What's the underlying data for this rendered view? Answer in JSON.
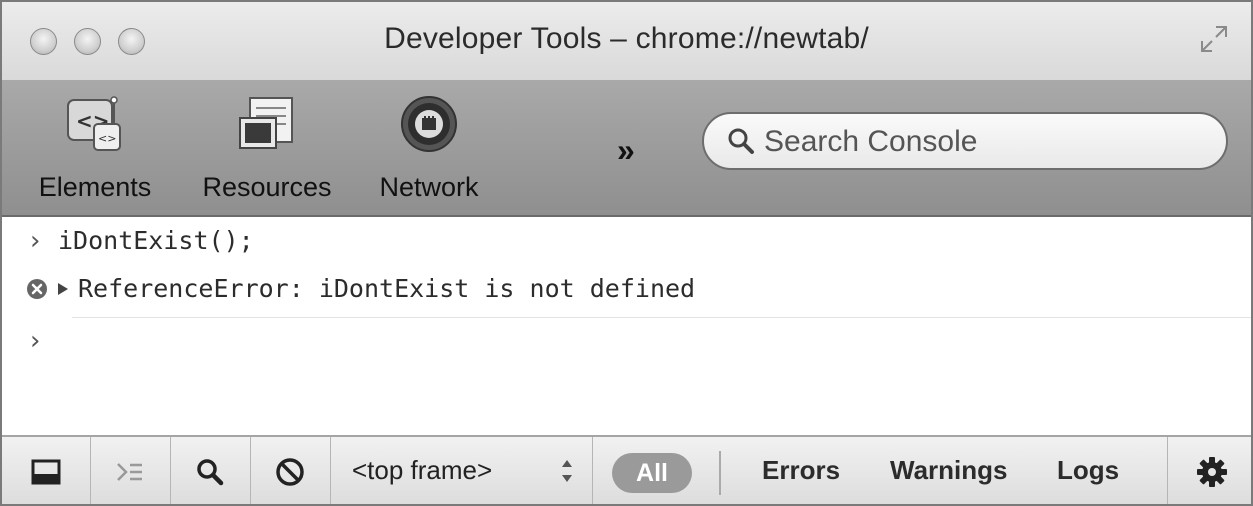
{
  "window": {
    "title": "Developer Tools – chrome://newtab/"
  },
  "toolbar": {
    "tools": [
      {
        "label": "Elements",
        "icon": "elements-icon"
      },
      {
        "label": "Resources",
        "icon": "resources-icon"
      },
      {
        "label": "Network",
        "icon": "network-icon"
      }
    ],
    "overflow_label": "»",
    "search": {
      "placeholder": "Search Console"
    }
  },
  "console": {
    "lines": [
      {
        "type": "input",
        "prompt": "›",
        "text": "iDontExist();"
      },
      {
        "type": "error",
        "text": "ReferenceError: iDontExist is not defined"
      },
      {
        "type": "prompt",
        "prompt": "›",
        "text": ""
      }
    ]
  },
  "statusbar": {
    "frame_selector": "<top frame>",
    "filters": {
      "all": "All",
      "errors": "Errors",
      "warnings": "Warnings",
      "logs": "Logs"
    }
  }
}
